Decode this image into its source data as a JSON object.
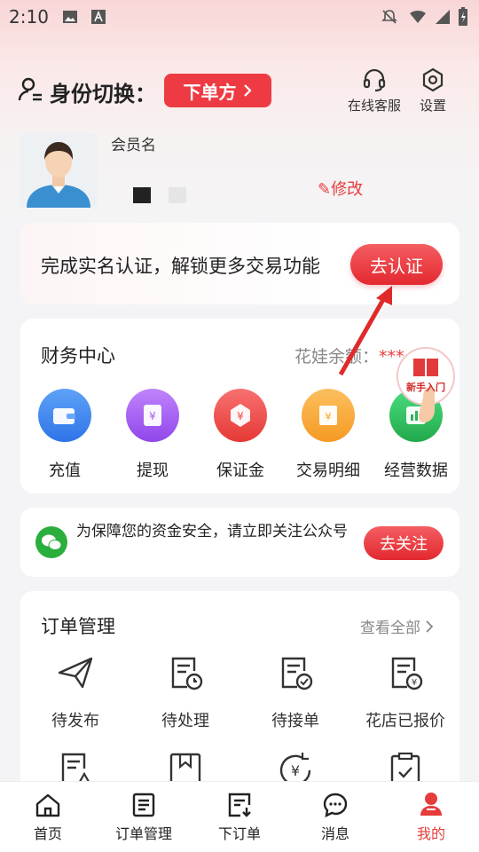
{
  "status_bar": {
    "time": "2:10"
  },
  "header": {
    "identity_label": "身份切换：",
    "role_button": "下单方",
    "customer_service": "在线客服",
    "settings": "设置"
  },
  "profile": {
    "member_name": "会员名",
    "edit": "修改"
  },
  "verify": {
    "text": "完成实名认证，解锁更多交易功能",
    "button": "去认证"
  },
  "finance": {
    "title": "财务中心",
    "balance_label": "花娃余额：",
    "balance_value": "***",
    "items": [
      {
        "label": "充值",
        "icon": "wallet-icon",
        "color": "#3b82f1"
      },
      {
        "label": "提现",
        "icon": "withdraw-icon",
        "color": "#a45cf0"
      },
      {
        "label": "保证金",
        "icon": "deposit-icon",
        "color": "#f04a4a"
      },
      {
        "label": "交易明细",
        "icon": "ledger-icon",
        "color": "#f5a623"
      },
      {
        "label": "经营数据",
        "icon": "chart-icon",
        "color": "#2fb35a"
      }
    ]
  },
  "guide": {
    "label": "新手入门"
  },
  "wechat": {
    "text": "为保障您的资金安全，请立即关注公众号",
    "button": "去关注"
  },
  "orders": {
    "title": "订单管理",
    "view_all": "查看全部",
    "items": [
      {
        "label": "待发布",
        "icon": "send-icon"
      },
      {
        "label": "待处理",
        "icon": "pending-icon"
      },
      {
        "label": "待接单",
        "icon": "accept-icon"
      },
      {
        "label": "花店已报价",
        "icon": "quote-icon"
      }
    ],
    "row2_icons": [
      "warning-doc-icon",
      "bookmark-doc-icon",
      "refund-icon",
      "clipboard-check-icon"
    ]
  },
  "tabs": [
    {
      "label": "首页",
      "icon": "home-icon"
    },
    {
      "label": "订单管理",
      "icon": "order-list-icon"
    },
    {
      "label": "下订单",
      "icon": "place-order-icon"
    },
    {
      "label": "消息",
      "icon": "message-icon"
    },
    {
      "label": "我的",
      "icon": "profile-icon",
      "active": true
    }
  ],
  "colors": {
    "accent": "#ee3b43",
    "wechat": "#2aae3d"
  }
}
